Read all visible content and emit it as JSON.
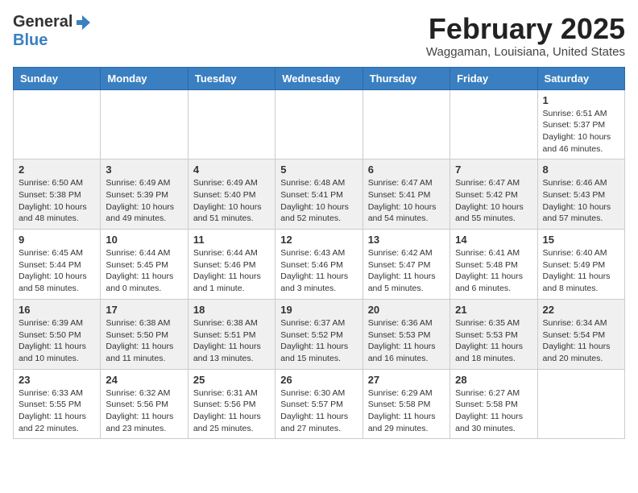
{
  "header": {
    "logo_line1": "General",
    "logo_line2": "Blue",
    "month_year": "February 2025",
    "location": "Waggaman, Louisiana, United States"
  },
  "days_of_week": [
    "Sunday",
    "Monday",
    "Tuesday",
    "Wednesday",
    "Thursday",
    "Friday",
    "Saturday"
  ],
  "weeks": [
    [
      {
        "num": "",
        "info": ""
      },
      {
        "num": "",
        "info": ""
      },
      {
        "num": "",
        "info": ""
      },
      {
        "num": "",
        "info": ""
      },
      {
        "num": "",
        "info": ""
      },
      {
        "num": "",
        "info": ""
      },
      {
        "num": "1",
        "info": "Sunrise: 6:51 AM\nSunset: 5:37 PM\nDaylight: 10 hours and 46 minutes."
      }
    ],
    [
      {
        "num": "2",
        "info": "Sunrise: 6:50 AM\nSunset: 5:38 PM\nDaylight: 10 hours and 48 minutes."
      },
      {
        "num": "3",
        "info": "Sunrise: 6:49 AM\nSunset: 5:39 PM\nDaylight: 10 hours and 49 minutes."
      },
      {
        "num": "4",
        "info": "Sunrise: 6:49 AM\nSunset: 5:40 PM\nDaylight: 10 hours and 51 minutes."
      },
      {
        "num": "5",
        "info": "Sunrise: 6:48 AM\nSunset: 5:41 PM\nDaylight: 10 hours and 52 minutes."
      },
      {
        "num": "6",
        "info": "Sunrise: 6:47 AM\nSunset: 5:41 PM\nDaylight: 10 hours and 54 minutes."
      },
      {
        "num": "7",
        "info": "Sunrise: 6:47 AM\nSunset: 5:42 PM\nDaylight: 10 hours and 55 minutes."
      },
      {
        "num": "8",
        "info": "Sunrise: 6:46 AM\nSunset: 5:43 PM\nDaylight: 10 hours and 57 minutes."
      }
    ],
    [
      {
        "num": "9",
        "info": "Sunrise: 6:45 AM\nSunset: 5:44 PM\nDaylight: 10 hours and 58 minutes."
      },
      {
        "num": "10",
        "info": "Sunrise: 6:44 AM\nSunset: 5:45 PM\nDaylight: 11 hours and 0 minutes."
      },
      {
        "num": "11",
        "info": "Sunrise: 6:44 AM\nSunset: 5:46 PM\nDaylight: 11 hours and 1 minute."
      },
      {
        "num": "12",
        "info": "Sunrise: 6:43 AM\nSunset: 5:46 PM\nDaylight: 11 hours and 3 minutes."
      },
      {
        "num": "13",
        "info": "Sunrise: 6:42 AM\nSunset: 5:47 PM\nDaylight: 11 hours and 5 minutes."
      },
      {
        "num": "14",
        "info": "Sunrise: 6:41 AM\nSunset: 5:48 PM\nDaylight: 11 hours and 6 minutes."
      },
      {
        "num": "15",
        "info": "Sunrise: 6:40 AM\nSunset: 5:49 PM\nDaylight: 11 hours and 8 minutes."
      }
    ],
    [
      {
        "num": "16",
        "info": "Sunrise: 6:39 AM\nSunset: 5:50 PM\nDaylight: 11 hours and 10 minutes."
      },
      {
        "num": "17",
        "info": "Sunrise: 6:38 AM\nSunset: 5:50 PM\nDaylight: 11 hours and 11 minutes."
      },
      {
        "num": "18",
        "info": "Sunrise: 6:38 AM\nSunset: 5:51 PM\nDaylight: 11 hours and 13 minutes."
      },
      {
        "num": "19",
        "info": "Sunrise: 6:37 AM\nSunset: 5:52 PM\nDaylight: 11 hours and 15 minutes."
      },
      {
        "num": "20",
        "info": "Sunrise: 6:36 AM\nSunset: 5:53 PM\nDaylight: 11 hours and 16 minutes."
      },
      {
        "num": "21",
        "info": "Sunrise: 6:35 AM\nSunset: 5:53 PM\nDaylight: 11 hours and 18 minutes."
      },
      {
        "num": "22",
        "info": "Sunrise: 6:34 AM\nSunset: 5:54 PM\nDaylight: 11 hours and 20 minutes."
      }
    ],
    [
      {
        "num": "23",
        "info": "Sunrise: 6:33 AM\nSunset: 5:55 PM\nDaylight: 11 hours and 22 minutes."
      },
      {
        "num": "24",
        "info": "Sunrise: 6:32 AM\nSunset: 5:56 PM\nDaylight: 11 hours and 23 minutes."
      },
      {
        "num": "25",
        "info": "Sunrise: 6:31 AM\nSunset: 5:56 PM\nDaylight: 11 hours and 25 minutes."
      },
      {
        "num": "26",
        "info": "Sunrise: 6:30 AM\nSunset: 5:57 PM\nDaylight: 11 hours and 27 minutes."
      },
      {
        "num": "27",
        "info": "Sunrise: 6:29 AM\nSunset: 5:58 PM\nDaylight: 11 hours and 29 minutes."
      },
      {
        "num": "28",
        "info": "Sunrise: 6:27 AM\nSunset: 5:58 PM\nDaylight: 11 hours and 30 minutes."
      },
      {
        "num": "",
        "info": ""
      }
    ]
  ]
}
